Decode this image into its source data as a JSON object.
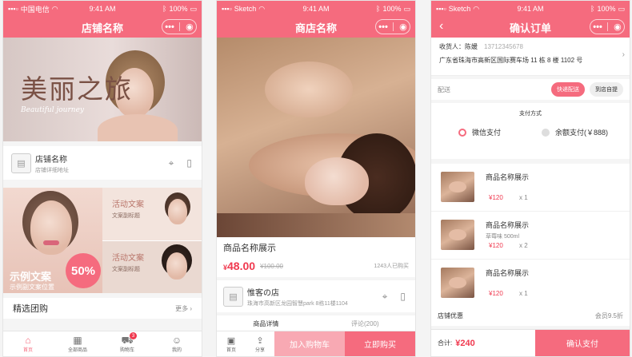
{
  "status_left": [
    "中国电信",
    "Sketch",
    "Sketch"
  ],
  "status_time": "9:41 AM",
  "status_battery": "100%",
  "capsule_dots": "•••",
  "phone1": {
    "title": "店铺名称",
    "banner_title": "美丽之旅",
    "banner_subtitle": "Beautiful journey",
    "shop_name": "店铺名称",
    "shop_address": "店铺详细地址",
    "promo_title": "示例文案",
    "promo_sub": "示例副文案位置",
    "promo_pct": "50%",
    "activity1_title": "活动文案",
    "activity1_sub": "文案副标题",
    "activity2_title": "活动文案",
    "activity2_sub": "文案副标题",
    "section_title": "精选团购",
    "section_more": "更多",
    "tabs": [
      {
        "label": "首页",
        "icon": "home-icon"
      },
      {
        "label": "全部商品",
        "icon": "grid-icon"
      },
      {
        "label": "购物车",
        "icon": "cart-icon",
        "badge": "3"
      },
      {
        "label": "我的",
        "icon": "user-icon"
      }
    ]
  },
  "phone2": {
    "title": "商店名称",
    "product_name": "商品名称展示",
    "price_symbol": "¥",
    "price": "48.00",
    "old_price": "¥100.00",
    "sold": "1243人已购买",
    "store_name": "惟客の店",
    "store_address": "珠海市高新区龙园智慧park 8栋11楼1104",
    "detail_tab": "商品详情",
    "review_tab": "评论(200)",
    "home_label": "首页",
    "share_label": "分享",
    "add_cart": "加入购物车",
    "buy_now": "立即购买"
  },
  "phone3": {
    "title": "确认订单",
    "receiver": "收货人：陈媛",
    "phone": "13712345678",
    "address": "广东省珠海市高新区国际赛车场 11 栋 8 楼 1102 号",
    "delivery_label": "配送",
    "delivery_fast": "快递配送",
    "delivery_pickup": "到店自提",
    "pay_title": "支付方式",
    "pay_wechat": "微信支付",
    "pay_balance": "余额支付(￥888)",
    "items": [
      {
        "name": "商品名称展示",
        "spec": "",
        "price": "¥120",
        "qty": "x 1"
      },
      {
        "name": "商品名称展示",
        "spec": "草莓味   500ml",
        "price": "¥120",
        "qty": "x 2"
      },
      {
        "name": "商品名称展示",
        "spec": "",
        "price": "¥120",
        "qty": "x 1"
      }
    ],
    "discount_label": "店铺优惠",
    "discount_value": "会员9.5折",
    "total_label": "合计:",
    "total_value": "¥240",
    "confirm": "确认支付"
  }
}
